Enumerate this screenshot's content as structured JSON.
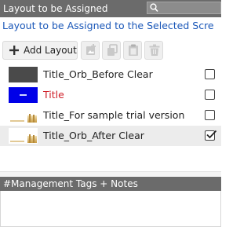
{
  "header": {
    "title": "Layout to be Assigned",
    "search_placeholder": ""
  },
  "subtitle": "Layout to be Assigned to the Selected Scre",
  "toolbar": {
    "add_layout_label": "Add Layout",
    "icons": [
      "add-image-icon",
      "copy-icon",
      "paste-icon",
      "trash-icon"
    ]
  },
  "layouts": [
    {
      "label": "Title_Orb_Before Clear",
      "checked": false,
      "thumb": "dark"
    },
    {
      "label": "Title",
      "checked": false,
      "thumb": "blue",
      "label_color": "#d0202a"
    },
    {
      "label": "Title_For sample trial version",
      "checked": false,
      "thumb": "light"
    },
    {
      "label": "Title_Orb_After Clear",
      "checked": true,
      "thumb": "light",
      "selected": true
    }
  ],
  "notes": {
    "title": "#Management Tags + Notes",
    "value": ""
  },
  "colors": {
    "header_bg": "#6b6b6b",
    "link_blue": "#1a57b8",
    "selected_row": "#ececec"
  }
}
